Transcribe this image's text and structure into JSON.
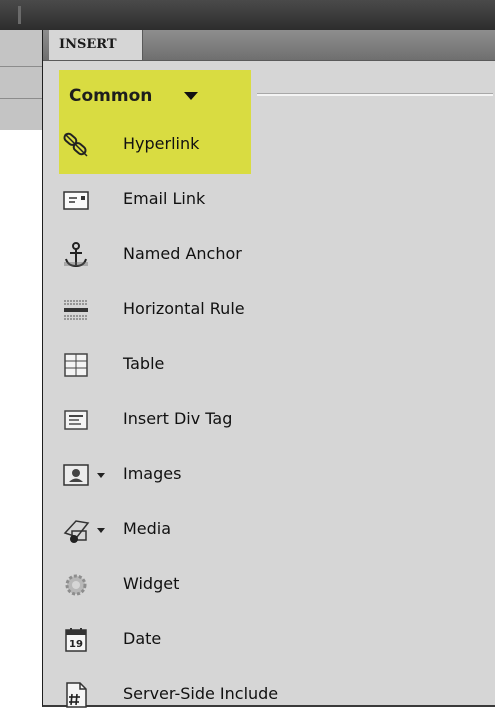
{
  "panel": {
    "tab_label": "INSERT",
    "category_label": "Common",
    "items": [
      {
        "label": "Hyperlink",
        "icon": "hyperlink-icon"
      },
      {
        "label": "Email Link",
        "icon": "email-link-icon"
      },
      {
        "label": "Named Anchor",
        "icon": "named-anchor-icon"
      },
      {
        "label": "Horizontal Rule",
        "icon": "horizontal-rule-icon"
      },
      {
        "label": "Table",
        "icon": "table-icon"
      },
      {
        "label": "Insert Div Tag",
        "icon": "div-tag-icon"
      },
      {
        "label": "Images",
        "icon": "images-icon",
        "has_dropdown": true
      },
      {
        "label": "Media",
        "icon": "media-icon",
        "has_dropdown": true
      },
      {
        "label": "Widget",
        "icon": "widget-icon"
      },
      {
        "label": "Date",
        "icon": "date-icon",
        "date_day": "19"
      },
      {
        "label": "Server-Side Include",
        "icon": "server-side-include-icon"
      }
    ]
  },
  "colors": {
    "highlight": "#d9dc41",
    "panel_bg": "#d6d6d6"
  }
}
